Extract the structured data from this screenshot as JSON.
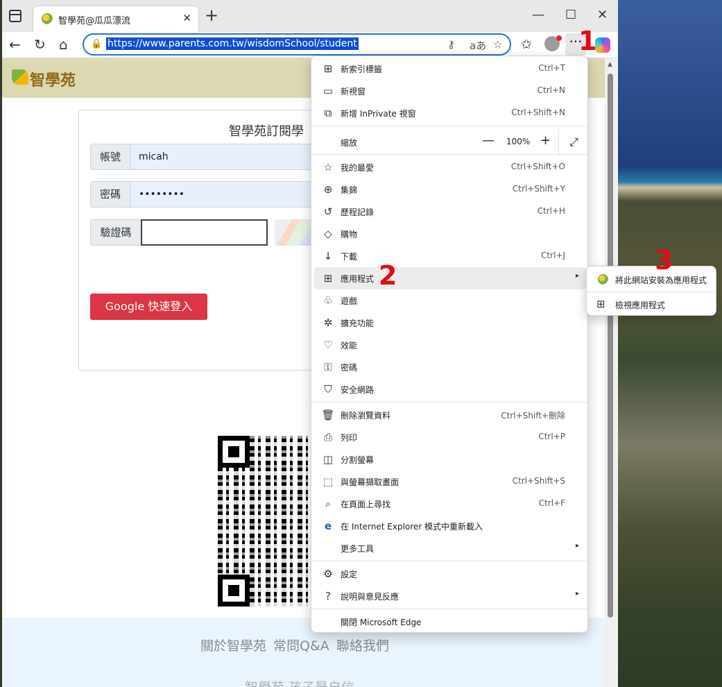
{
  "tab": {
    "title": "智學苑@瓜瓜漂流",
    "close": "✕",
    "new_tab": "+"
  },
  "window_controls": {
    "minimize": "—",
    "maximize": "☐",
    "close": "✕"
  },
  "address_bar": {
    "url": "https://www.parents.com.tw/wisdomSchool/student"
  },
  "annotations": {
    "step1": "1",
    "step2": "2",
    "step3": "3"
  },
  "site": {
    "name": "智學苑",
    "login_title": "智學苑訂閱學",
    "account_label": "帳號",
    "account_value": "micah",
    "password_label": "密碼",
    "password_value": "••••••••",
    "captcha_label": "驗證碼",
    "google_button": "Google 快速登入",
    "footer_links": "關於智學苑  常問Q&A  聯絡我們",
    "footer_sub": "智學苑  孩子最自信"
  },
  "menu": {
    "items_top": [
      {
        "icon": "⊞",
        "label": "新索引標籤",
        "shortcut": "Ctrl+T"
      },
      {
        "icon": "▭",
        "label": "新視窗",
        "shortcut": "Ctrl+N"
      },
      {
        "icon": "⧉",
        "label": "新增 InPrivate 視窗",
        "shortcut": "Ctrl+Shift+N"
      }
    ],
    "zoom": {
      "label": "縮放",
      "minus": "—",
      "value": "100%",
      "plus": "+",
      "fullscreen": "⤢"
    },
    "items_mid": [
      {
        "icon": "☆",
        "label": "我的最愛",
        "shortcut": "Ctrl+Shift+O"
      },
      {
        "icon": "⊕",
        "label": "集錦",
        "shortcut": "Ctrl+Shift+Y"
      },
      {
        "icon": "↺",
        "label": "歷程記錄",
        "shortcut": "Ctrl+H"
      },
      {
        "icon": "◇",
        "label": "購物",
        "shortcut": ""
      },
      {
        "icon": "↓",
        "label": "下載",
        "shortcut": "Ctrl+J"
      },
      {
        "icon": "⊞",
        "label": "應用程式",
        "shortcut": ""
      },
      {
        "icon": "♧",
        "label": "遊戲",
        "shortcut": ""
      },
      {
        "icon": "✲",
        "label": "擴充功能",
        "shortcut": ""
      },
      {
        "icon": "♡",
        "label": "效能",
        "shortcut": ""
      },
      {
        "icon": "⚿",
        "label": "密碼",
        "shortcut": ""
      },
      {
        "icon": "⛉",
        "label": "安全網路",
        "shortcut": ""
      }
    ],
    "items_tools": [
      {
        "icon": "🗑",
        "label": "刪除瀏覽資料",
        "shortcut": "Ctrl+Shift+刪除"
      },
      {
        "icon": "⎙",
        "label": "列印",
        "shortcut": "Ctrl+P"
      },
      {
        "icon": "◫",
        "label": "分割螢幕",
        "shortcut": ""
      },
      {
        "icon": "⬚",
        "label": "與螢幕擷取畫面",
        "shortcut": "Ctrl+Shift+S"
      },
      {
        "icon": "⌕",
        "label": "在頁面上尋找",
        "shortcut": "Ctrl+F"
      },
      {
        "icon": "e",
        "label": "在 Internet Explorer 模式中重新載入",
        "shortcut": ""
      },
      {
        "icon": "",
        "label": "更多工具",
        "shortcut": ""
      }
    ],
    "items_bottom": [
      {
        "icon": "⚙",
        "label": "設定",
        "shortcut": ""
      },
      {
        "icon": "?",
        "label": "說明與意見反應",
        "shortcut": ""
      }
    ],
    "close_label": "關閉 Microsoft Edge",
    "arrow": "▸"
  },
  "submenu": {
    "install_label": "將此網站安裝為應用程式",
    "view_label": "檢視應用程式",
    "view_icon": "⊞"
  }
}
